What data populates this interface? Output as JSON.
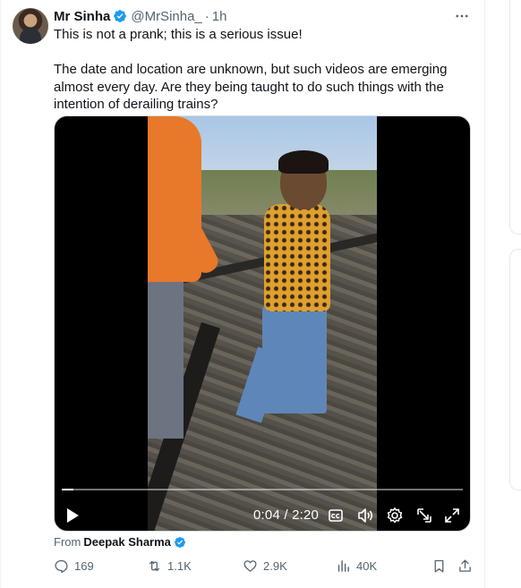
{
  "author": {
    "name": "Mr Sinha",
    "handle": "@MrSinha_",
    "separator": "·",
    "time": "1h"
  },
  "tweet": {
    "line1": "This is not a prank; this is a serious issue!",
    "line2": "The date and location are unknown, but such videos are emerging almost every day. Are they being taught to do such things with the intention of derailing trains?"
  },
  "video": {
    "timecode": "0:04 / 2:20",
    "progress": 0.029
  },
  "source": {
    "prefix": "From",
    "name": "Deepak Sharma"
  },
  "actions": {
    "replies": "169",
    "retweets": "1.1K",
    "likes": "2.9K",
    "views": "40K"
  },
  "colors": {
    "verified": "#1d9bf0",
    "text": "#0f1419",
    "muted": "#536471"
  }
}
